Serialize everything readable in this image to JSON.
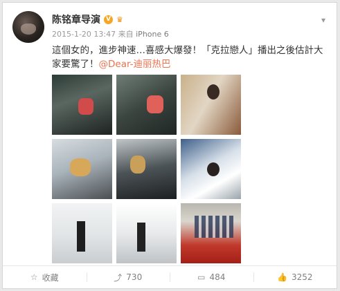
{
  "post": {
    "author": "陈铭章导演",
    "verified_badge": "V",
    "crown_icon": "crown-icon",
    "timestamp": "2015-1-20 13:47",
    "source_prefix": "来自",
    "source": "iPhone 6",
    "text_main": "這個女的，進步神速…喜感大爆發！「克拉戀人」播出之後估計大家要驚了！",
    "mention": "@Dear-迪丽热巴",
    "menu_icon": "chevron-down-icon"
  },
  "photos": [
    {
      "name": "photo-1"
    },
    {
      "name": "photo-2"
    },
    {
      "name": "photo-3"
    },
    {
      "name": "photo-4"
    },
    {
      "name": "photo-5"
    },
    {
      "name": "photo-6"
    },
    {
      "name": "photo-7"
    },
    {
      "name": "photo-8"
    },
    {
      "name": "photo-9"
    }
  ],
  "actions": {
    "favorite_label": "收藏",
    "repost_count": "730",
    "comment_count": "484",
    "like_count": "3252"
  },
  "colors": {
    "mention": "#eb7350",
    "verified": "#f6a623",
    "text": "#333333",
    "meta": "#999999"
  }
}
